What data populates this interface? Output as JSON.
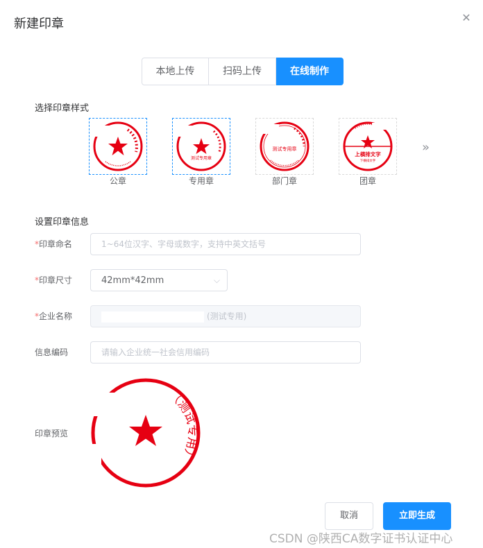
{
  "dialog": {
    "title": "新建印章"
  },
  "tabs": [
    {
      "label": "本地上传",
      "active": false
    },
    {
      "label": "扫码上传",
      "active": false
    },
    {
      "label": "在线制作",
      "active": true
    }
  ],
  "seal_style": {
    "section_title": "选择印章样式",
    "options": [
      {
        "label": "公章",
        "selected": true
      },
      {
        "label": "专用章",
        "selected": true
      },
      {
        "label": "部门章",
        "selected": false
      },
      {
        "label": "团章",
        "selected": false
      }
    ],
    "more_icon": "double-chevron-right-icon"
  },
  "seal_info": {
    "section_title": "设置印章信息",
    "name": {
      "label": "印章命名",
      "required": true,
      "placeholder": "1~64位汉字、字母或数字，支持中英文括号",
      "value": ""
    },
    "size": {
      "label": "印章尺寸",
      "required": true,
      "value": "42mm*42mm"
    },
    "company": {
      "label": "企业名称",
      "required": true,
      "suffix": "(测试专用)",
      "disabled": true
    },
    "code": {
      "label": "信息编码",
      "required": false,
      "placeholder": "请输入企业统一社会信用编码",
      "value": ""
    }
  },
  "preview": {
    "label": "印章预览",
    "seal_text": "（测试专用）"
  },
  "thumb_texts": {
    "dept": "测试专用章",
    "group_main": "上横排文字",
    "group_sub": "下横排文字",
    "special": "测试专用章"
  },
  "actions": {
    "cancel": "取消",
    "create": "立即生成"
  },
  "watermark": "CSDN @陕西CA数字证书认证中心",
  "colors": {
    "accent": "#1890ff",
    "seal_red": "#e60012",
    "required": "#f56c6c"
  }
}
